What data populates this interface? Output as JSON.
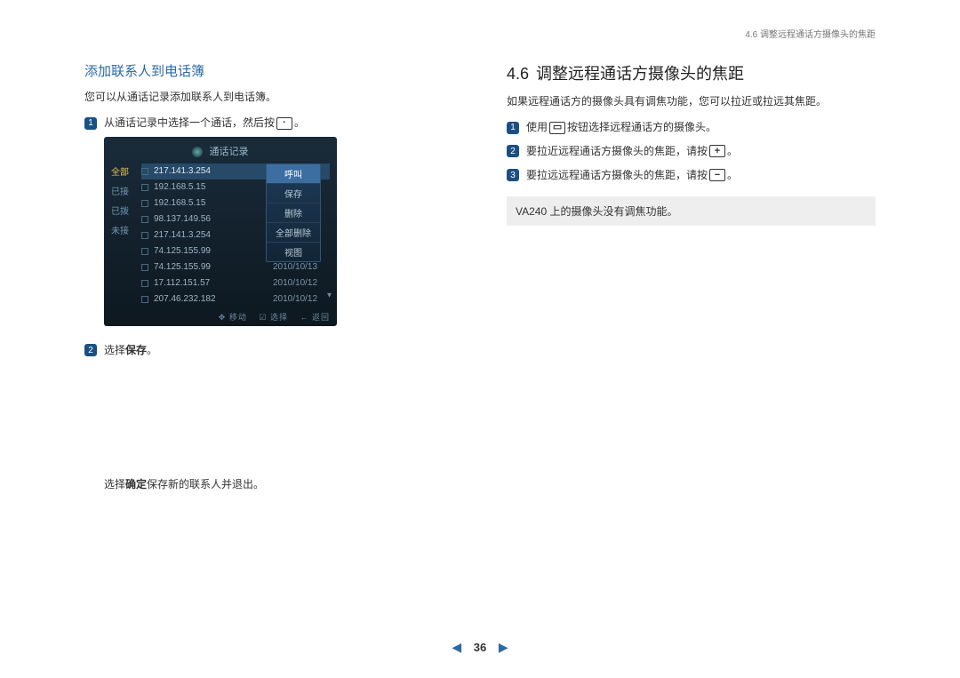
{
  "header": {
    "breadcrumb": "4.6 调整远程通话方摄像头的焦距"
  },
  "left": {
    "subheading": "添加联系人到电话簿",
    "intro": "您可以从通话记录添加联系人到电话簿。",
    "step1_a": "从通话记录中选择一个通话，然后按",
    "step1_b": "。",
    "step2_a": "选择",
    "step2_b": "保存",
    "step2_c": "。",
    "closing_a": "选择",
    "closing_b": "确定",
    "closing_c": "保存新的联系人并退出。"
  },
  "device": {
    "title": "通话记录",
    "side": [
      {
        "label": "全部",
        "active": true
      },
      {
        "label": "已接",
        "active": false
      },
      {
        "label": "已拨",
        "active": false
      },
      {
        "label": "未接",
        "active": false
      }
    ],
    "rows": [
      {
        "ip": "217.141.3.254",
        "date": "",
        "selected": true
      },
      {
        "ip": "192.168.5.15",
        "date": ""
      },
      {
        "ip": "192.168.5.15",
        "date": ""
      },
      {
        "ip": "98.137.149.56",
        "date": ""
      },
      {
        "ip": "217.141.3.254",
        "date": ""
      },
      {
        "ip": "74.125.155.99",
        "date": ""
      },
      {
        "ip": "74.125.155.99",
        "date": "2010/10/13"
      },
      {
        "ip": "17.112.151.57",
        "date": "2010/10/12"
      },
      {
        "ip": "207.46.232.182",
        "date": "2010/10/12"
      }
    ],
    "menu": [
      "呼叫",
      "保存",
      "删除",
      "全部删除",
      "视图"
    ],
    "footer": {
      "move": "移动",
      "select": "选择",
      "back": "返回"
    }
  },
  "right": {
    "section_num": "4.6",
    "section_title": "调整远程通话方摄像头的焦距",
    "intro": "如果远程通话方的摄像头具有调焦功能，您可以拉近或拉远其焦距。",
    "step1_a": "使用",
    "step1_b": "按钮选择远程通话方的摄像头。",
    "step2_a": "要拉近远程通话方摄像头的焦距，请按",
    "step2_b": "。",
    "step3_a": "要拉远远程通话方摄像头的焦距，请按",
    "step3_b": "。",
    "note": "VA240 上的摄像头没有调焦功能。"
  },
  "pager": {
    "page": "36"
  },
  "icons": {
    "dot_button": "·",
    "camera": "▭",
    "plus": "+",
    "minus": "−",
    "move": "✥ ",
    "select": "☑ ",
    "back": "← ",
    "prev": "◀",
    "next": "▶"
  }
}
